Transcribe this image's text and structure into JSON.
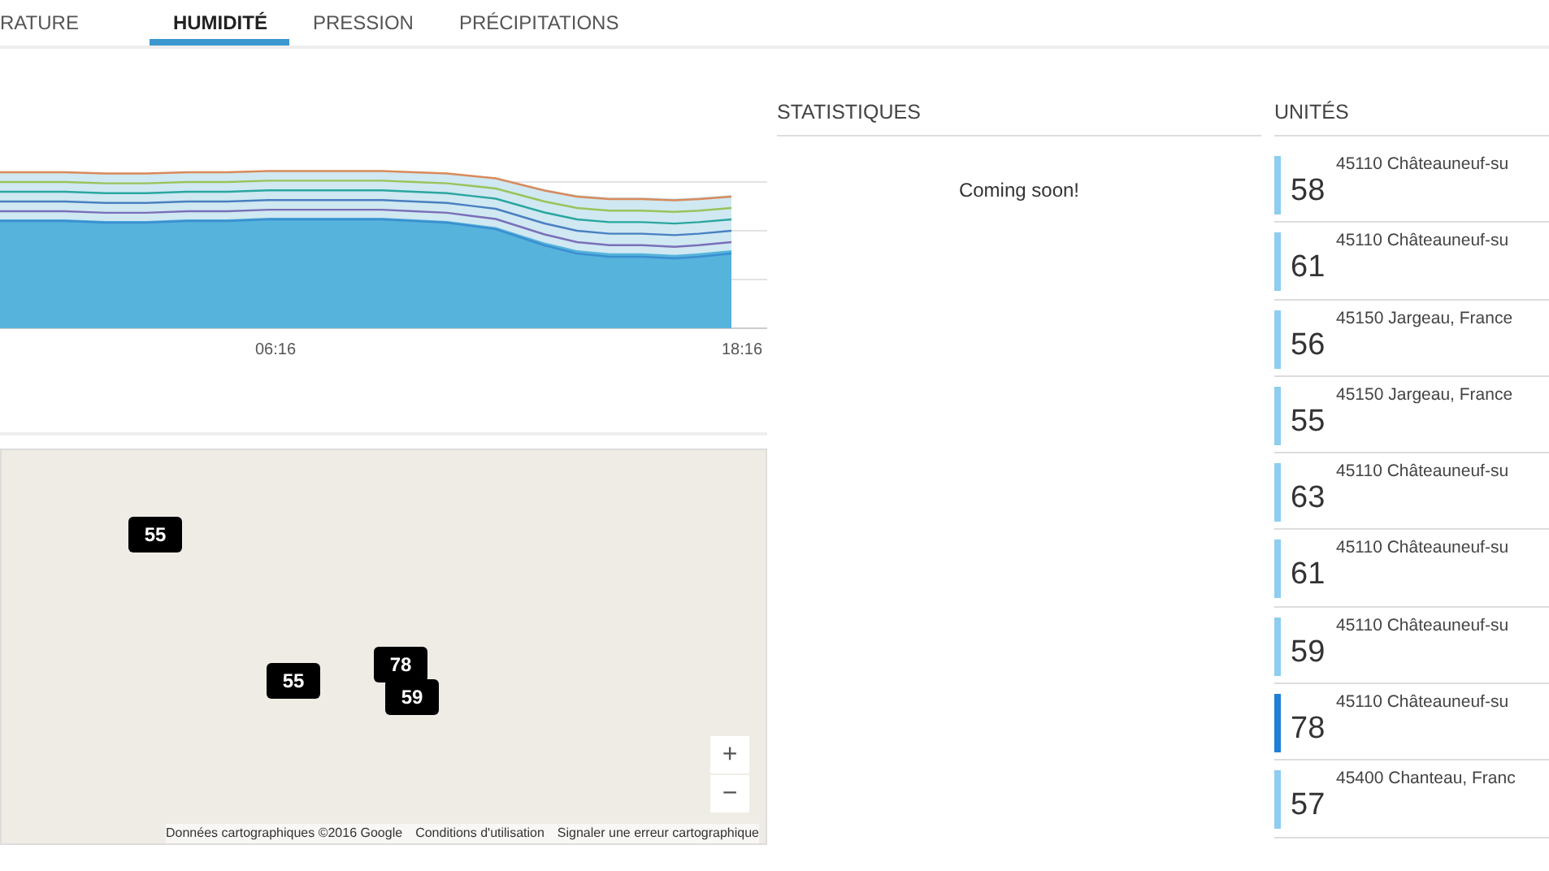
{
  "tabs": [
    {
      "label": "RATURE",
      "selected": false
    },
    {
      "label": "HUMIDITÉ",
      "selected": true
    },
    {
      "label": "PRESSION",
      "selected": false
    },
    {
      "label": "PRÉCIPITATIONS",
      "selected": false
    }
  ],
  "chart": {
    "x_labels": [
      "06:16",
      "18:16"
    ]
  },
  "map": {
    "markers": [
      "55",
      "55",
      "78",
      "59"
    ],
    "zoom_in": "+",
    "zoom_out": "−",
    "attribution": [
      "Données cartographiques ©2016 Google",
      "Conditions d'utilisation",
      "Signaler une erreur cartographique"
    ]
  },
  "statistics": {
    "title": "STATISTIQUES",
    "message": "Coming soon!"
  },
  "units": {
    "title": "UNITÉS",
    "items": [
      {
        "value": "58",
        "location": "45110 Châteauneuf-su",
        "selected": false
      },
      {
        "value": "61",
        "location": "45110 Châteauneuf-su",
        "selected": false
      },
      {
        "value": "56",
        "location": "45150 Jargeau, France",
        "selected": false
      },
      {
        "value": "55",
        "location": "45150 Jargeau, France",
        "selected": false
      },
      {
        "value": "63",
        "location": "45110 Châteauneuf-su",
        "selected": false
      },
      {
        "value": "61",
        "location": "45110 Châteauneuf-su",
        "selected": false
      },
      {
        "value": "59",
        "location": "45110 Châteauneuf-su",
        "selected": false
      },
      {
        "value": "78",
        "location": "45110 Châteauneuf-su",
        "selected": true
      },
      {
        "value": "57",
        "location": "45400 Chanteau, Franc",
        "selected": false
      }
    ]
  }
}
